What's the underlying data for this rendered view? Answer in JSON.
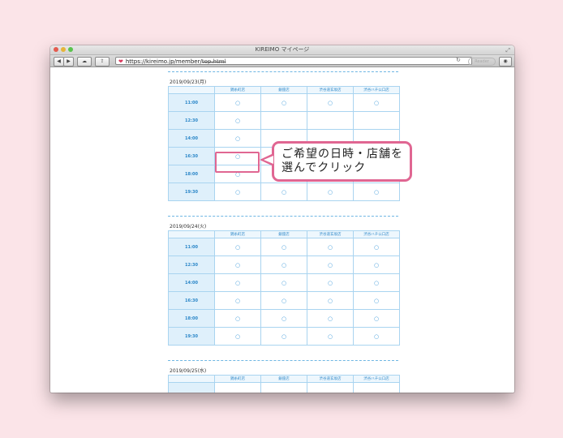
{
  "window": {
    "title": "KIREIMO マイページ",
    "url_prefix": "https://kireimo.jp/member/",
    "url_struck": "top.html",
    "reader_label": "Reader",
    "reload_icon": "reload-icon"
  },
  "callout": {
    "line1": "ご希望の日時・店舗を",
    "line2": "選んでクリック"
  },
  "columns": [
    "",
    "錦糸町店",
    "銀座店",
    "渋谷道玄坂店",
    "渋谷ハチ公口店"
  ],
  "mark": "○",
  "days": [
    {
      "date": "2019/09/23(月)",
      "rows": [
        {
          "time": "11:00",
          "cells": [
            "○",
            "○",
            "○",
            "○"
          ]
        },
        {
          "time": "12:30",
          "cells": [
            "○",
            "",
            "",
            ""
          ]
        },
        {
          "time": "14:00",
          "cells": [
            "○",
            "",
            "",
            ""
          ]
        },
        {
          "time": "16:30",
          "cells": [
            "○",
            "",
            "",
            ""
          ]
        },
        {
          "time": "18:00",
          "cells": [
            "○",
            "○",
            "○",
            "○"
          ]
        },
        {
          "time": "19:30",
          "cells": [
            "○",
            "○",
            "○",
            "○"
          ]
        }
      ]
    },
    {
      "date": "2019/09/24(火)",
      "rows": [
        {
          "time": "11:00",
          "cells": [
            "○",
            "○",
            "○",
            "○"
          ]
        },
        {
          "time": "12:30",
          "cells": [
            "○",
            "○",
            "○",
            "○"
          ]
        },
        {
          "time": "14:00",
          "cells": [
            "○",
            "○",
            "○",
            "○"
          ]
        },
        {
          "time": "16:30",
          "cells": [
            "○",
            "○",
            "○",
            "○"
          ]
        },
        {
          "time": "18:00",
          "cells": [
            "○",
            "○",
            "○",
            "○"
          ]
        },
        {
          "time": "19:30",
          "cells": [
            "○",
            "○",
            "○",
            "○"
          ]
        }
      ]
    },
    {
      "date": "2019/09/25(水)",
      "rows": []
    }
  ]
}
